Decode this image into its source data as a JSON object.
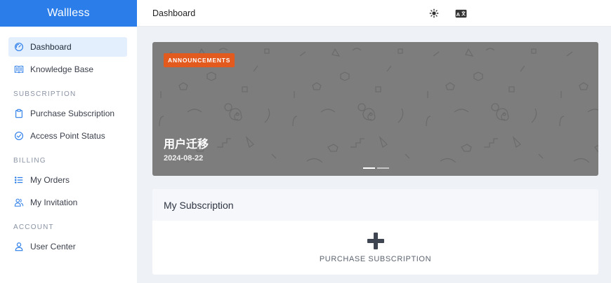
{
  "brand": {
    "name": "Wallless",
    "color": "#2b7de9"
  },
  "header": {
    "title": "Dashboard",
    "icons": [
      "sun-icon",
      "translate-icon"
    ]
  },
  "sidebar": {
    "items": [
      {
        "label": "Dashboard",
        "icon": "gauge-icon",
        "active": true
      },
      {
        "label": "Knowledge Base",
        "icon": "book-icon"
      }
    ],
    "sections": [
      {
        "label": "SUBSCRIPTION",
        "items": [
          {
            "label": "Purchase Subscription",
            "icon": "clipboard-icon"
          },
          {
            "label": "Access Point Status",
            "icon": "check-circle-icon"
          }
        ]
      },
      {
        "label": "BILLING",
        "items": [
          {
            "label": "My Orders",
            "icon": "list-icon"
          },
          {
            "label": "My Invitation",
            "icon": "users-icon"
          }
        ]
      },
      {
        "label": "ACCOUNT",
        "items": [
          {
            "label": "User Center",
            "icon": "user-icon"
          }
        ]
      }
    ]
  },
  "banner": {
    "badge": "ANNOUNCEMENTS",
    "title": "用户迁移",
    "date": "2024-08-22",
    "slides_total": 2,
    "slide_active": 1,
    "badge_color": "#e35a1f"
  },
  "subscription": {
    "title": "My Subscription",
    "action_label": "PURCHASE SUBSCRIPTION"
  }
}
